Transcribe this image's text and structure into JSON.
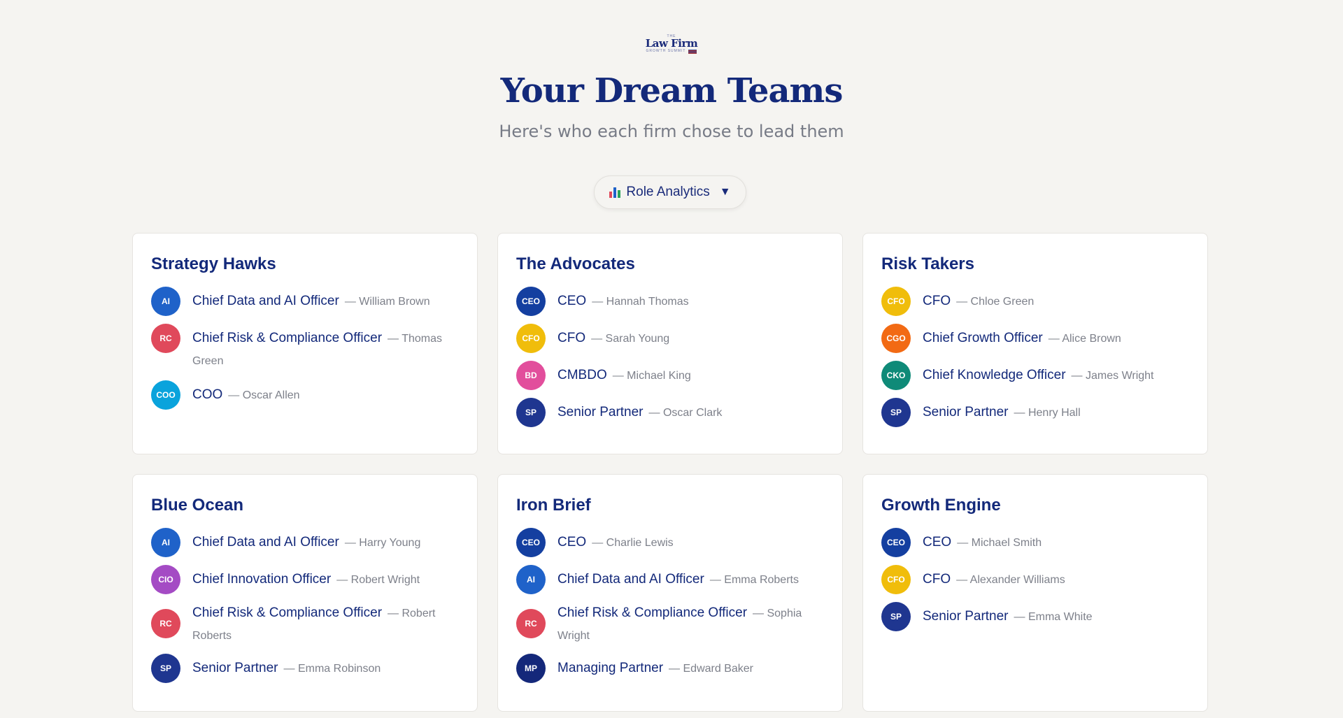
{
  "logo": {
    "top": "THE",
    "main": "Law Firm",
    "sub": "GROWTH SUMMIT"
  },
  "header": {
    "title": "Your Dream Teams",
    "subtitle": "Here's who each firm chose to lead them"
  },
  "analytics": {
    "label": "Role Analytics",
    "icon": "bar-chart-icon",
    "caret": "▼"
  },
  "colors": {
    "AI": "#1f62c9",
    "RC": "#e0495b",
    "COO": "#0aa3dc",
    "CEO": "#143fa0",
    "CFO": "#f0bd0b",
    "BD": "#e24e9c",
    "SP": "#1f3690",
    "CGO": "#f26a14",
    "CKO": "#0f8a78",
    "CIO": "#a44bc4",
    "MP": "#14287a"
  },
  "teams": [
    {
      "name": "Strategy Hawks",
      "members": [
        {
          "abbr": "AI",
          "role": "Chief Data and AI Officer",
          "person": "— William Brown"
        },
        {
          "abbr": "RC",
          "role": "Chief Risk & Compliance Officer",
          "person": "— Thomas Green"
        },
        {
          "abbr": "COO",
          "role": "COO",
          "person": "— Oscar Allen"
        }
      ]
    },
    {
      "name": "The Advocates",
      "members": [
        {
          "abbr": "CEO",
          "role": "CEO",
          "person": "— Hannah Thomas"
        },
        {
          "abbr": "CFO",
          "role": "CFO",
          "person": "— Sarah Young"
        },
        {
          "abbr": "BD",
          "role": "CMBDO",
          "person": "— Michael King"
        },
        {
          "abbr": "SP",
          "role": "Senior Partner",
          "person": "— Oscar Clark"
        }
      ]
    },
    {
      "name": "Risk Takers",
      "members": [
        {
          "abbr": "CFO",
          "role": "CFO",
          "person": "— Chloe Green"
        },
        {
          "abbr": "CGO",
          "role": "Chief Growth Officer",
          "person": "— Alice Brown"
        },
        {
          "abbr": "CKO",
          "role": "Chief Knowledge Officer",
          "person": "— James Wright"
        },
        {
          "abbr": "SP",
          "role": "Senior Partner",
          "person": "— Henry Hall"
        }
      ]
    },
    {
      "name": "Blue Ocean",
      "members": [
        {
          "abbr": "AI",
          "role": "Chief Data and AI Officer",
          "person": "— Harry Young"
        },
        {
          "abbr": "CIO",
          "role": "Chief Innovation Officer",
          "person": "— Robert Wright"
        },
        {
          "abbr": "RC",
          "role": "Chief Risk & Compliance Officer",
          "person": "— Robert Roberts"
        },
        {
          "abbr": "SP",
          "role": "Senior Partner",
          "person": "— Emma Robinson"
        }
      ]
    },
    {
      "name": "Iron Brief",
      "members": [
        {
          "abbr": "CEO",
          "role": "CEO",
          "person": "— Charlie Lewis"
        },
        {
          "abbr": "AI",
          "role": "Chief Data and AI Officer",
          "person": "— Emma Roberts"
        },
        {
          "abbr": "RC",
          "role": "Chief Risk & Compliance Officer",
          "person": "— Sophia Wright"
        },
        {
          "abbr": "MP",
          "role": "Managing Partner",
          "person": "— Edward Baker"
        }
      ]
    },
    {
      "name": "Growth Engine",
      "members": [
        {
          "abbr": "CEO",
          "role": "CEO",
          "person": "— Michael Smith"
        },
        {
          "abbr": "CFO",
          "role": "CFO",
          "person": "— Alexander Williams"
        },
        {
          "abbr": "SP",
          "role": "Senior Partner",
          "person": "— Emma White"
        }
      ]
    }
  ]
}
